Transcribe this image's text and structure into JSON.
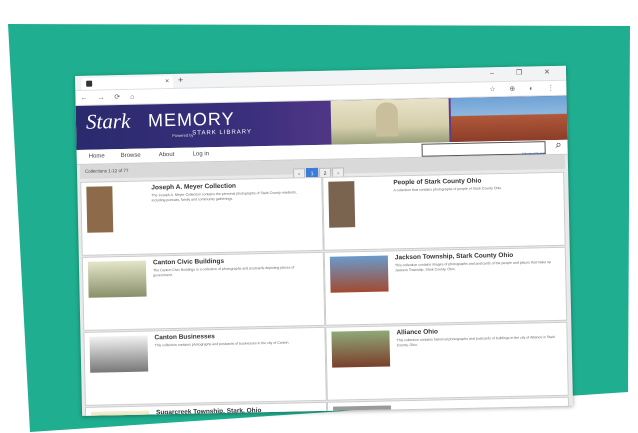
{
  "browser": {
    "tab_title": "",
    "tab_close": "×",
    "new_tab": "+",
    "window_controls": "– ❐ ✕",
    "nav": "← → ⟳ ⌂",
    "extensions": "☆ ⊕ ◐ ⋮"
  },
  "banner": {
    "stark": "Stark",
    "memory": "MEMORY",
    "powered": "Powered by",
    "library": "STARK LIBRARY"
  },
  "menu": {
    "items": [
      "Home",
      "Browse",
      "About",
      "Log in"
    ],
    "search_placeholder": "",
    "advanced_search": "Advanced Search",
    "search_icon": "search-icon"
  },
  "results": {
    "count": "Collections 1-12 of 77",
    "pages": [
      "‹",
      "1",
      "2",
      "›"
    ]
  },
  "cards": [
    {
      "title": "Joseph A. Meyer Collection",
      "desc": "The Joseph A. Meyer Collection contains the personal photographs of Stark County residents, including portraits, family and community gatherings."
    },
    {
      "title": "People of Stark County Ohio",
      "desc": "A collection that contains photographs of people of Stark County Ohio."
    },
    {
      "title": "Canton Civic Buildings",
      "desc": "The Canton Civic Buildings is a collection of photographs and postcards depicting places of government."
    },
    {
      "title": "Jackson Township, Stark County Ohio",
      "desc": "This collection contains images of photographs and postcards of the people and places that make up Jackson Township, Stark County, Ohio."
    },
    {
      "title": "Canton Businesses",
      "desc": "This collection contains photographs and postcards of businesses in the city of Canton."
    },
    {
      "title": "Alliance Ohio",
      "desc": "This collection contains historical photographs and postcards of buildings in the city of Alliance in Stark County, Ohio."
    },
    {
      "title": "Sugarcreek Township, Stark, Ohio",
      "desc": ""
    },
    {
      "title": "",
      "desc": ""
    }
  ],
  "colors": {
    "teal": "#1fae8f",
    "banner": "#3a2f7c",
    "active_page": "#3b7dd8"
  }
}
